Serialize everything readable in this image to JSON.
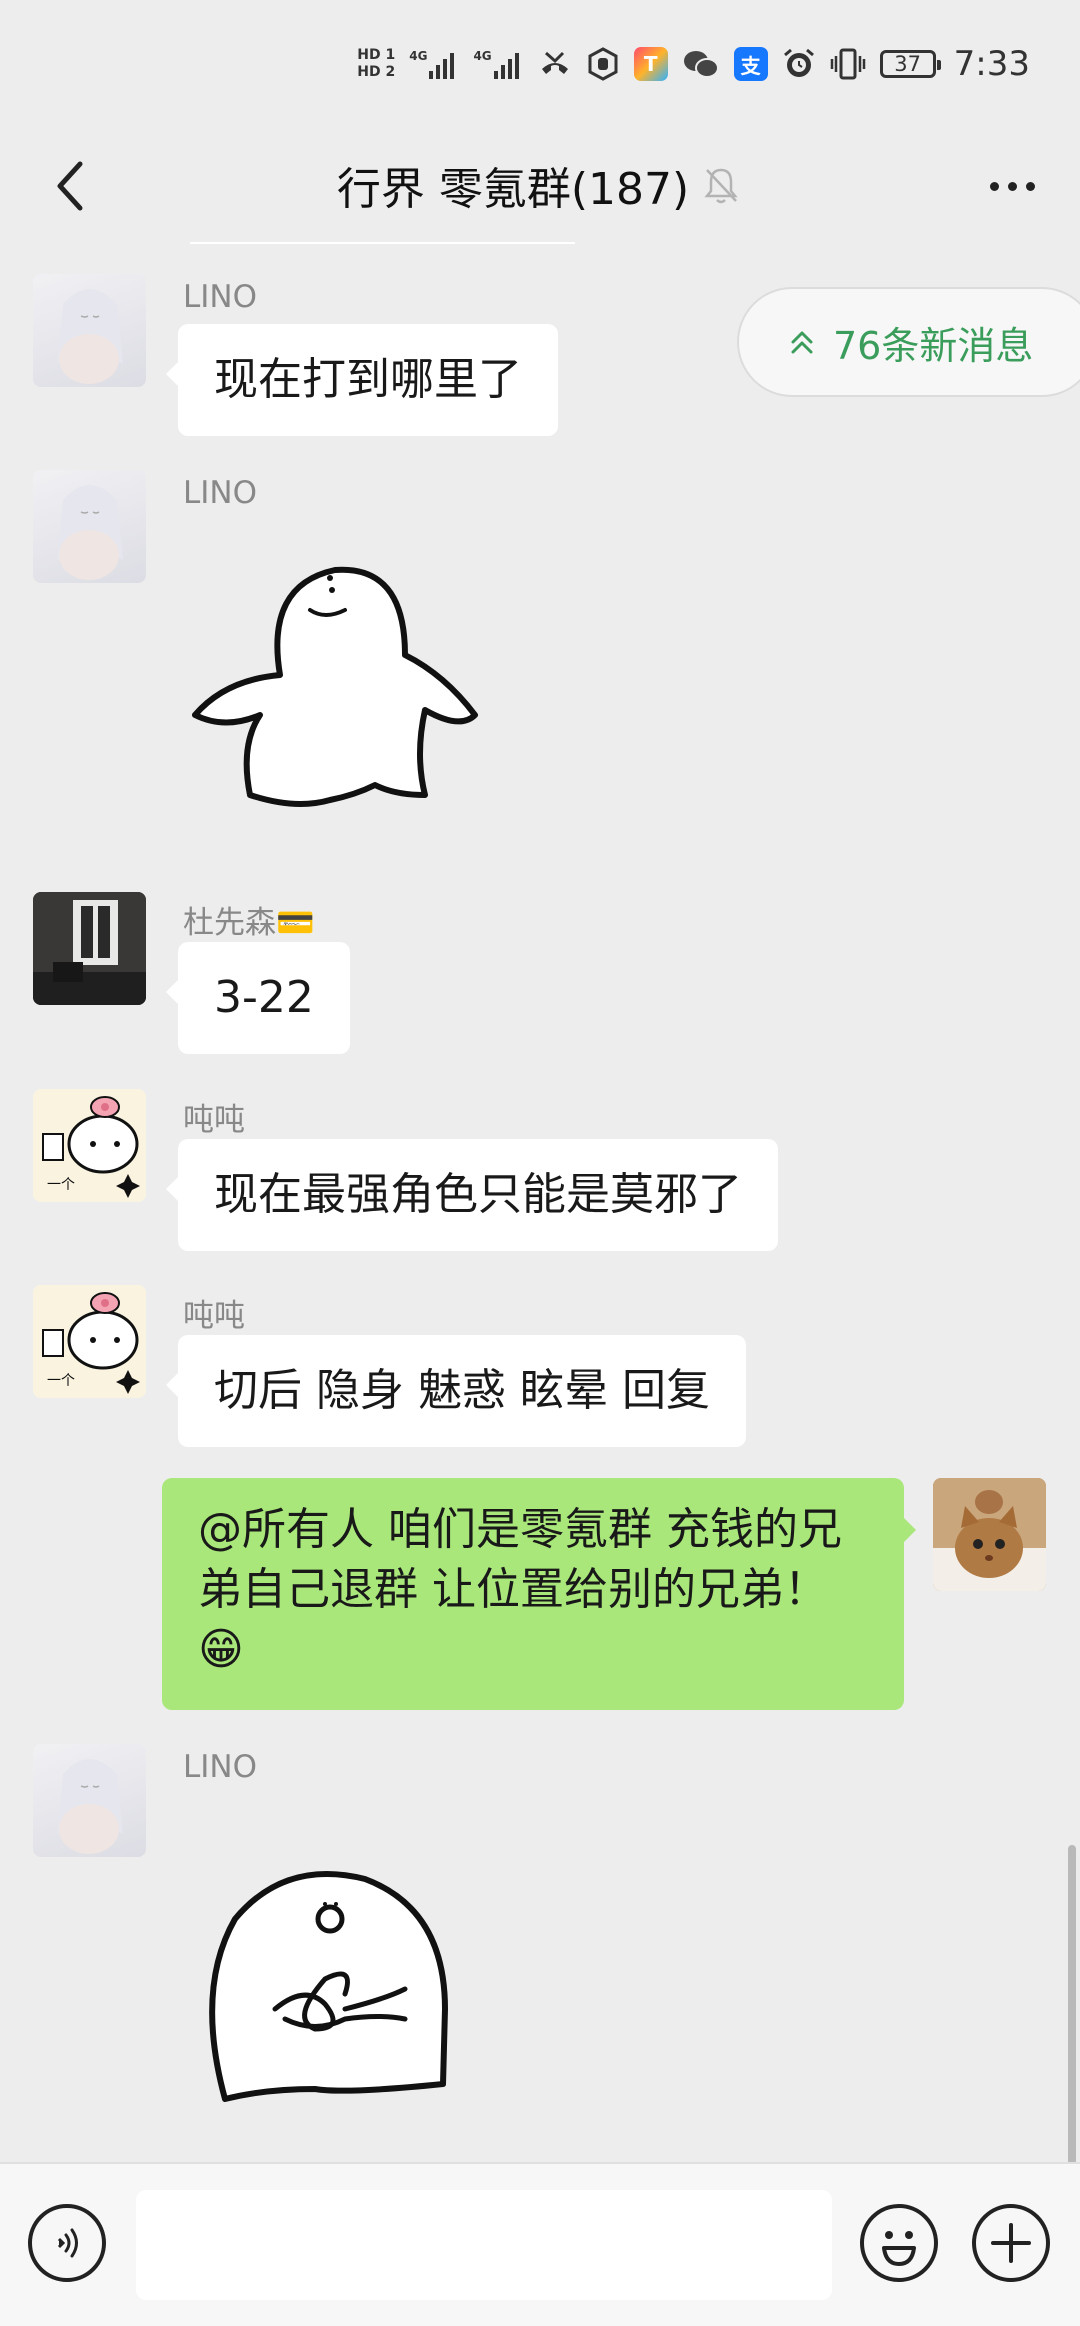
{
  "status_bar": {
    "sim1": "HD 1",
    "sim2": "HD 2",
    "net1": "4G",
    "net2": "4G",
    "battery": "37",
    "time": "7:33",
    "icons": [
      "hd-icon",
      "signal-icon",
      "missed-call-icon",
      "hand-icon",
      "app-icon",
      "wechat-icon",
      "alipay-icon",
      "alarm-icon",
      "vibrate-icon",
      "battery-icon"
    ]
  },
  "header": {
    "title": "行界 零氪群(187)",
    "back_icon": "back-arrow-icon",
    "mute_icon": "bell-off-icon",
    "more_icon": "more-dots-icon"
  },
  "new_messages": {
    "label": "76条新消息",
    "icon": "double-chevron-up-icon"
  },
  "messages": [
    {
      "sender": "LINO",
      "type": "text",
      "text": "现在打到哪里了",
      "side": "left"
    },
    {
      "sender": "LINO",
      "type": "sticker",
      "sticker": "white-ghost-sticker",
      "side": "left"
    },
    {
      "sender": "杜先森💳",
      "type": "text",
      "text": "3-22",
      "side": "left"
    },
    {
      "sender": "吨吨",
      "type": "text",
      "text": "现在最强角色只能是莫邪了",
      "side": "left"
    },
    {
      "sender": "吨吨",
      "type": "text",
      "text": "切后 隐身 魅惑 眩晕 回复",
      "side": "left"
    },
    {
      "sender": "",
      "type": "text",
      "text": "@所有人  咱们是零氪群 充钱的兄弟自己退群 让位置给别的兄弟！😁",
      "side": "right"
    },
    {
      "sender": "LINO",
      "type": "sticker",
      "sticker": "white-blob-sticker",
      "side": "left"
    }
  ],
  "input_bar": {
    "voice_icon": "voice-icon",
    "input_value": "",
    "emoji_icon": "emoji-icon",
    "plus_icon": "plus-icon"
  },
  "colors": {
    "background": "#ededed",
    "bubble_left": "#ffffff",
    "bubble_right": "#a9e77a",
    "accent_green": "#3b9d5b"
  }
}
